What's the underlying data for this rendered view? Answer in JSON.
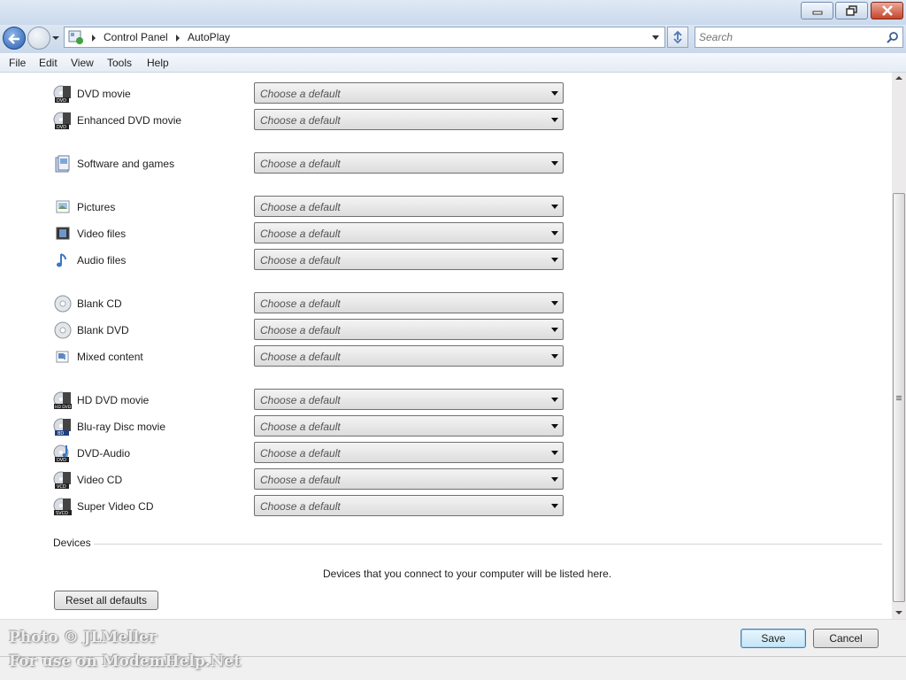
{
  "window": {
    "buttons": {
      "minimize_icon": "minimize-icon",
      "maximize_icon": "restore-icon",
      "close_icon": "close-icon"
    }
  },
  "navigation": {
    "breadcrumbs": [
      "Control Panel",
      "AutoPlay"
    ],
    "search_placeholder": "Search"
  },
  "menu": [
    "File",
    "Edit",
    "View",
    "Tools",
    "Help"
  ],
  "media_rows": [
    {
      "label": "DVD movie",
      "value": "Choose a default",
      "icon": "dvd-movie-icon"
    },
    {
      "label": "Enhanced DVD movie",
      "value": "Choose a default",
      "icon": "enhanced-dvd-icon"
    },
    {
      "label": "Software and games",
      "value": "Choose a default",
      "icon": "software-games-icon"
    },
    {
      "label": "Pictures",
      "value": "Choose a default",
      "icon": "pictures-icon"
    },
    {
      "label": "Video files",
      "value": "Choose a default",
      "icon": "video-files-icon"
    },
    {
      "label": "Audio files",
      "value": "Choose a default",
      "icon": "audio-files-icon"
    },
    {
      "label": "Blank CD",
      "value": "Choose a default",
      "icon": "blank-cd-icon"
    },
    {
      "label": "Blank DVD",
      "value": "Choose a default",
      "icon": "blank-dvd-icon"
    },
    {
      "label": "Mixed content",
      "value": "Choose a default",
      "icon": "mixed-content-icon"
    },
    {
      "label": "HD DVD movie",
      "value": "Choose a default",
      "icon": "hd-dvd-icon"
    },
    {
      "label": "Blu-ray Disc movie",
      "value": "Choose a default",
      "icon": "bluray-icon"
    },
    {
      "label": "DVD-Audio",
      "value": "Choose a default",
      "icon": "dvd-audio-icon"
    },
    {
      "label": "Video CD",
      "value": "Choose a default",
      "icon": "video-cd-icon"
    },
    {
      "label": "Super Video CD",
      "value": "Choose a default",
      "icon": "super-video-cd-icon"
    }
  ],
  "devices": {
    "header": "Devices",
    "message": "Devices that you connect to your computer will be listed here."
  },
  "buttons": {
    "reset": "Reset all defaults",
    "save": "Save",
    "cancel": "Cancel"
  },
  "watermark": {
    "line1": "Photo © JLMeller",
    "line2": "For use on ModemHelp.Net"
  }
}
